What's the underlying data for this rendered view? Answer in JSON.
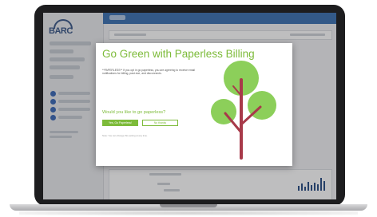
{
  "app": {
    "logo_text": "BARC"
  },
  "modal": {
    "title": "Go Green with Paperless Billing",
    "body": "**PAPERLESS** If you opt in go paperless, you are agreeing to receive email notifications for billing, past due, and disconnects.",
    "question": "Would you like to go paperless?",
    "primary_button": "Yes, Go Paperless!",
    "secondary_button": "No thanks",
    "footnote": "Note: You can change this setting at any time."
  },
  "colors": {
    "brand_green": "#7dbb3a",
    "tree_trunk": "#a83a4a",
    "topbar_blue": "#3f73b3",
    "laptop_body": "#1d1d1f"
  }
}
